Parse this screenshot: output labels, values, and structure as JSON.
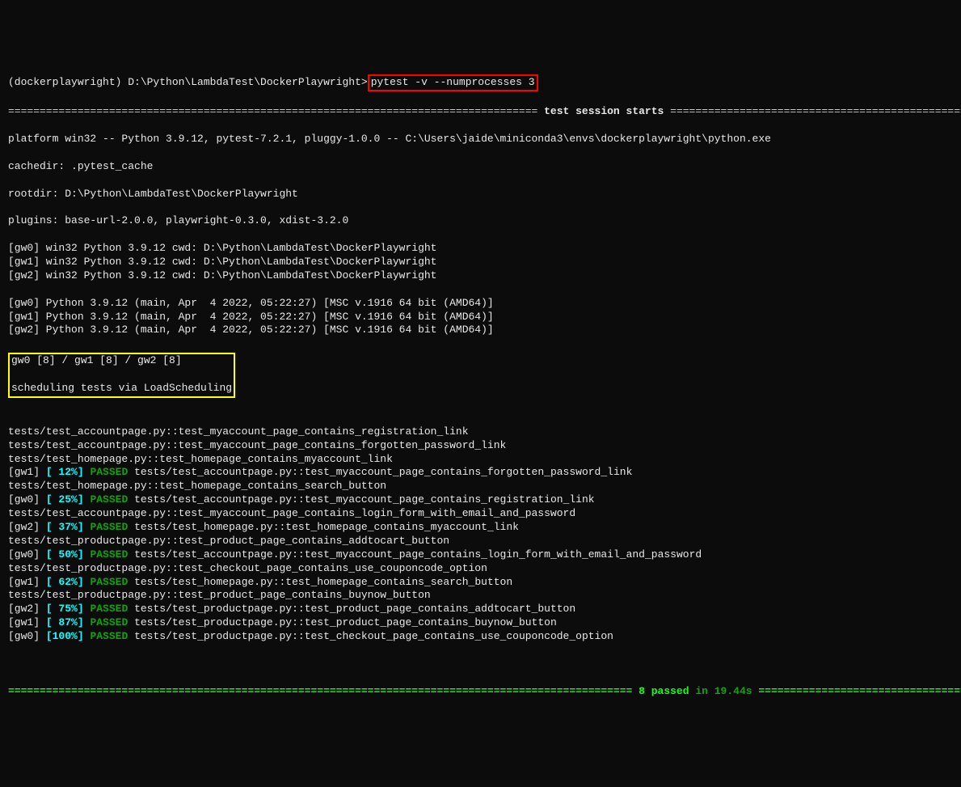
{
  "prompt": {
    "prefix": "(dockerplaywright) D:\\Python\\LambdaTest\\DockerPlaywright>",
    "command": "pytest -v --numprocesses 3"
  },
  "session_header": {
    "rule_char": "=",
    "label": " test session starts "
  },
  "platform_line": "platform win32 -- Python 3.9.12, pytest-7.2.1, pluggy-1.0.0 -- C:\\Users\\jaide\\miniconda3\\envs\\dockerplaywright\\python.exe",
  "cachedir_line": "cachedir: .pytest_cache",
  "rootdir_line": "rootdir: D:\\Python\\LambdaTest\\DockerPlaywright",
  "plugins_line": "plugins: base-url-2.0.0, playwright-0.3.0, xdist-3.2.0",
  "gw_cwd_lines": [
    "[gw0] win32 Python 3.9.12 cwd: D:\\Python\\LambdaTest\\DockerPlaywright",
    "[gw1] win32 Python 3.9.12 cwd: D:\\Python\\LambdaTest\\DockerPlaywright",
    "[gw2] win32 Python 3.9.12 cwd: D:\\Python\\LambdaTest\\DockerPlaywright"
  ],
  "gw_msc_lines": [
    "[gw0] Python 3.9.12 (main, Apr  4 2022, 05:22:27) [MSC v.1916 64 bit (AMD64)]",
    "[gw1] Python 3.9.12 (main, Apr  4 2022, 05:22:27) [MSC v.1916 64 bit (AMD64)]",
    "[gw2] Python 3.9.12 (main, Apr  4 2022, 05:22:27) [MSC v.1916 64 bit (AMD64)]"
  ],
  "workers_line": "gw0 [8] / gw1 [8] / gw2 [8]",
  "scheduling_line": "scheduling tests via LoadScheduling",
  "blocks": [
    {
      "type": "plain",
      "text": "tests/test_accountpage.py::test_myaccount_page_contains_registration_link"
    },
    {
      "type": "plain",
      "text": "tests/test_accountpage.py::test_myaccount_page_contains_forgotten_password_link"
    },
    {
      "type": "plain",
      "text": "tests/test_homepage.py::test_homepage_contains_myaccount_link"
    },
    {
      "type": "result",
      "worker": "[gw1]",
      "pct": "[ 12%]",
      "status": "PASSED",
      "test": " tests/test_accountpage.py::test_myaccount_page_contains_forgotten_password_link"
    },
    {
      "type": "plain",
      "text": "tests/test_homepage.py::test_homepage_contains_search_button"
    },
    {
      "type": "result",
      "worker": "[gw0]",
      "pct": "[ 25%]",
      "status": "PASSED",
      "test": " tests/test_accountpage.py::test_myaccount_page_contains_registration_link"
    },
    {
      "type": "plain",
      "text": "tests/test_accountpage.py::test_myaccount_page_contains_login_form_with_email_and_password"
    },
    {
      "type": "result",
      "worker": "[gw2]",
      "pct": "[ 37%]",
      "status": "PASSED",
      "test": " tests/test_homepage.py::test_homepage_contains_myaccount_link"
    },
    {
      "type": "plain",
      "text": "tests/test_productpage.py::test_product_page_contains_addtocart_button"
    },
    {
      "type": "result",
      "worker": "[gw0]",
      "pct": "[ 50%]",
      "status": "PASSED",
      "test": " tests/test_accountpage.py::test_myaccount_page_contains_login_form_with_email_and_password"
    },
    {
      "type": "plain",
      "text": "tests/test_productpage.py::test_checkout_page_contains_use_couponcode_option"
    },
    {
      "type": "result",
      "worker": "[gw1]",
      "pct": "[ 62%]",
      "status": "PASSED",
      "test": " tests/test_homepage.py::test_homepage_contains_search_button"
    },
    {
      "type": "plain",
      "text": "tests/test_productpage.py::test_product_page_contains_buynow_button"
    },
    {
      "type": "result",
      "worker": "[gw2]",
      "pct": "[ 75%]",
      "status": "PASSED",
      "test": " tests/test_productpage.py::test_product_page_contains_addtocart_button"
    },
    {
      "type": "result",
      "worker": "[gw1]",
      "pct": "[ 87%]",
      "status": "PASSED",
      "test": " tests/test_productpage.py::test_product_page_contains_buynow_button"
    },
    {
      "type": "result",
      "worker": "[gw0]",
      "pct": "[100%]",
      "status": "PASSED",
      "test": " tests/test_productpage.py::test_checkout_page_contains_use_couponcode_option"
    }
  ],
  "footer": {
    "passed": " 8 passed",
    "in": " in 19.44s "
  }
}
